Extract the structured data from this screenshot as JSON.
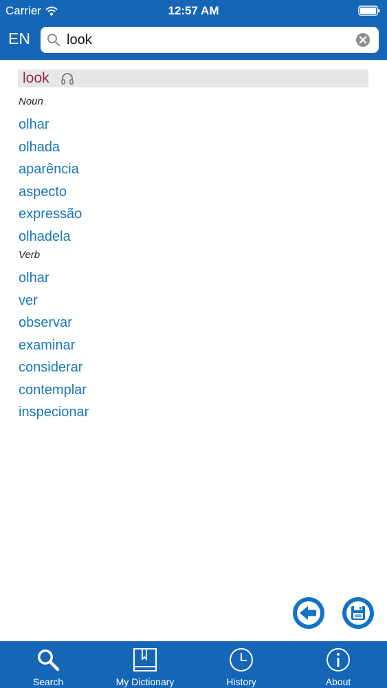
{
  "status_bar": {
    "carrier": "Carrier",
    "time": "12:57 AM"
  },
  "header": {
    "language": "EN",
    "search_value": "look"
  },
  "entry": {
    "headword": "look",
    "groups": [
      {
        "pos": "Noun",
        "translations": [
          "olhar",
          "olhada",
          "aparência",
          "aspecto",
          "expressão",
          "olhadela"
        ]
      },
      {
        "pos": "Verb",
        "translations": [
          "olhar",
          "ver",
          "observar",
          "examinar",
          "considerar",
          "contemplar",
          "inspecionar"
        ]
      }
    ]
  },
  "icons": {
    "audio": "headphones-icon",
    "back": "back-arrow-icon",
    "save": "floppy-save-icon",
    "clear": "clear-search-icon",
    "search": "magnifier-icon"
  },
  "tabs": [
    {
      "label": "Search",
      "icon": "search-icon"
    },
    {
      "label": "My Dictionary",
      "icon": "book-icon"
    },
    {
      "label": "History",
      "icon": "clock-icon"
    },
    {
      "label": "About",
      "icon": "info-icon"
    }
  ],
  "colors": {
    "brand": "#1666b8",
    "headword": "#8a2c52",
    "translation": "#1a78b5"
  }
}
